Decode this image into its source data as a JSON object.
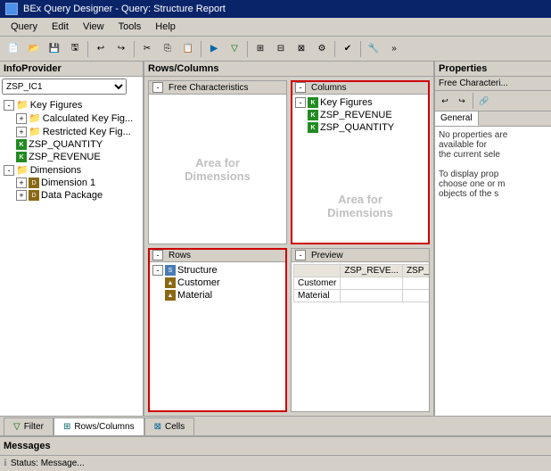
{
  "title": {
    "app": "BEx Query Designer",
    "query": "Query: Structure Report",
    "icon": "bex-icon"
  },
  "menu": {
    "items": [
      "Query",
      "Edit",
      "View",
      "Tools",
      "Help"
    ]
  },
  "toolbar": {
    "buttons": [
      "new",
      "open",
      "save",
      "save-as",
      "sep",
      "cut",
      "copy",
      "paste",
      "sep",
      "run",
      "filter",
      "sep",
      "cols",
      "rows",
      "cells",
      "sep",
      "props",
      "sep",
      "check",
      "sep",
      "settings"
    ]
  },
  "infoprovider": {
    "header": "InfoProvider",
    "provider_name": "ZSP_IC1",
    "tree": {
      "key_figures": {
        "label": "Key Figures",
        "children": {
          "calc": "Calculated Key Fig...",
          "restricted": "Restricted Key Fig...",
          "zsp_quantity": "ZSP_QUANTITY",
          "zsp_revenue": "ZSP_REVENUE"
        }
      },
      "dimensions": {
        "label": "Dimensions",
        "children": {
          "dim1": "Dimension 1",
          "data_package": "Data Package"
        }
      }
    }
  },
  "rows_columns": {
    "header": "Rows/Columns",
    "free_characteristics": {
      "label": "Free Characteristics",
      "area_text": "Area for\nDimensions"
    },
    "columns": {
      "label": "Columns",
      "key_figures_node": "Key Figures",
      "items": [
        "ZSP_REVENUE",
        "ZSP_QUANTITY"
      ],
      "area_text": "Area for\nDimensions"
    },
    "rows": {
      "label": "Rows",
      "structure": "Structure",
      "items": [
        "Customer",
        "Material"
      ],
      "area_text": ""
    },
    "preview": {
      "label": "Preview",
      "col_headers": [
        "ZSP_REVE...",
        "ZSP_QUAN..."
      ],
      "row_headers": [
        "Customer",
        "Material"
      ]
    }
  },
  "properties": {
    "header": "Properties",
    "subtitle": "Free Characteri...",
    "tabs": [
      "General"
    ],
    "active_tab": "General",
    "content_line1": "No properties are",
    "content_line2": "available for",
    "content_line3": "the current sele",
    "content_line4": "To display prop",
    "content_line5": "choose one or m",
    "content_line6": "objects of the s"
  },
  "bottom_tabs": [
    {
      "label": "Filter",
      "icon": "filter-icon",
      "active": false
    },
    {
      "label": "Rows/Columns",
      "icon": "table-icon",
      "active": true
    },
    {
      "label": "Cells",
      "icon": "cells-icon",
      "active": false
    }
  ],
  "messages": {
    "header": "Messages"
  },
  "status": {
    "text": "Status: Message..."
  }
}
